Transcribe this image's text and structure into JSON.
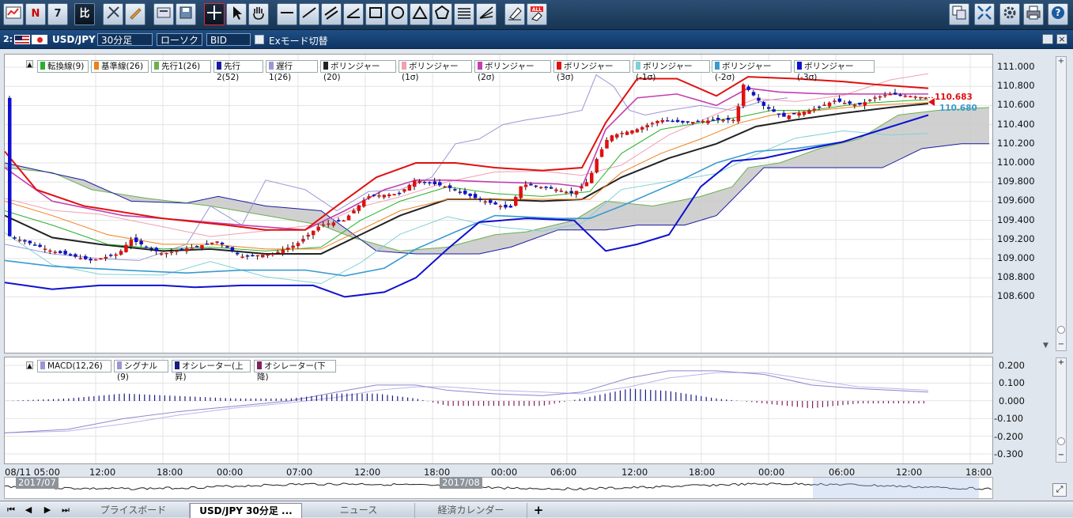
{
  "toolbar": {
    "hi_label": "比",
    "news_label": "N",
    "calendar_label": "7"
  },
  "symbol_bar": {
    "window_no": "2:",
    "symbol": "USD/JPY",
    "timeframe": "30分足",
    "chart_type": "ローソク",
    "price_type": "BID",
    "ex_mode": "Exモード切替"
  },
  "main_legend": [
    {
      "label": "転換線(9)",
      "color": "#2bb02b"
    },
    {
      "label": "基準線(26)",
      "color": "#f07f1a"
    },
    {
      "label": "先行1(26)",
      "color": "#6ab04c"
    },
    {
      "label": "先行2(52)",
      "color": "#1a1aa0"
    },
    {
      "label": "遅行1(26)",
      "color": "#9b95d6"
    },
    {
      "label": "ボリンジャー(20)",
      "color": "#222222"
    },
    {
      "label": "ボリンジャー(1σ)",
      "color": "#f0a0b0"
    },
    {
      "label": "ボリンジャー(2σ)",
      "color": "#c23fb0"
    },
    {
      "label": "ボリンジャー(3σ)",
      "color": "#e01010"
    },
    {
      "label": "ボリンジャー(-1σ)",
      "color": "#80d0d8"
    },
    {
      "label": "ボリンジャー(-2σ)",
      "color": "#3a9ad0"
    },
    {
      "label": "ボリンジャー(-3σ)",
      "color": "#1010d0"
    }
  ],
  "price_axis": [
    "111.000",
    "110.800",
    "110.600",
    "110.400",
    "110.200",
    "110.000",
    "109.800",
    "109.600",
    "109.400",
    "109.200",
    "109.000",
    "108.800",
    "108.600"
  ],
  "price_tags": {
    "ask": "110.683",
    "bid": "110.680"
  },
  "macd_legend": [
    {
      "label": "MACD(12,26)",
      "color": "#9b95d6"
    },
    {
      "label": "シグナル(9)",
      "color": "#9b95d6"
    },
    {
      "label": "オシレーター(上昇)",
      "color": "#1a1a80"
    },
    {
      "label": "オシレーター(下降)",
      "color": "#802060"
    }
  ],
  "macd_axis": [
    "0.200",
    "0.100",
    "0.000",
    "-0.100",
    "-0.200",
    "-0.300"
  ],
  "time_axis": [
    "08/11 05:00",
    "12:00",
    "18:00",
    "00:00",
    "07:00",
    "12:00",
    "18:00",
    "00:00",
    "06:00",
    "12:00",
    "18:00",
    "00:00",
    "06:00",
    "12:00",
    "18:00"
  ],
  "overview": {
    "month1": "2017/07",
    "month2": "2017/08"
  },
  "tabs": [
    "プライスボード",
    "USD/JPY 30分足 ...",
    "ニュース",
    "経済カレンダー"
  ],
  "colors": {
    "up": "#e01010",
    "down": "#1010d0",
    "cloud": "#c8c8c8"
  }
}
